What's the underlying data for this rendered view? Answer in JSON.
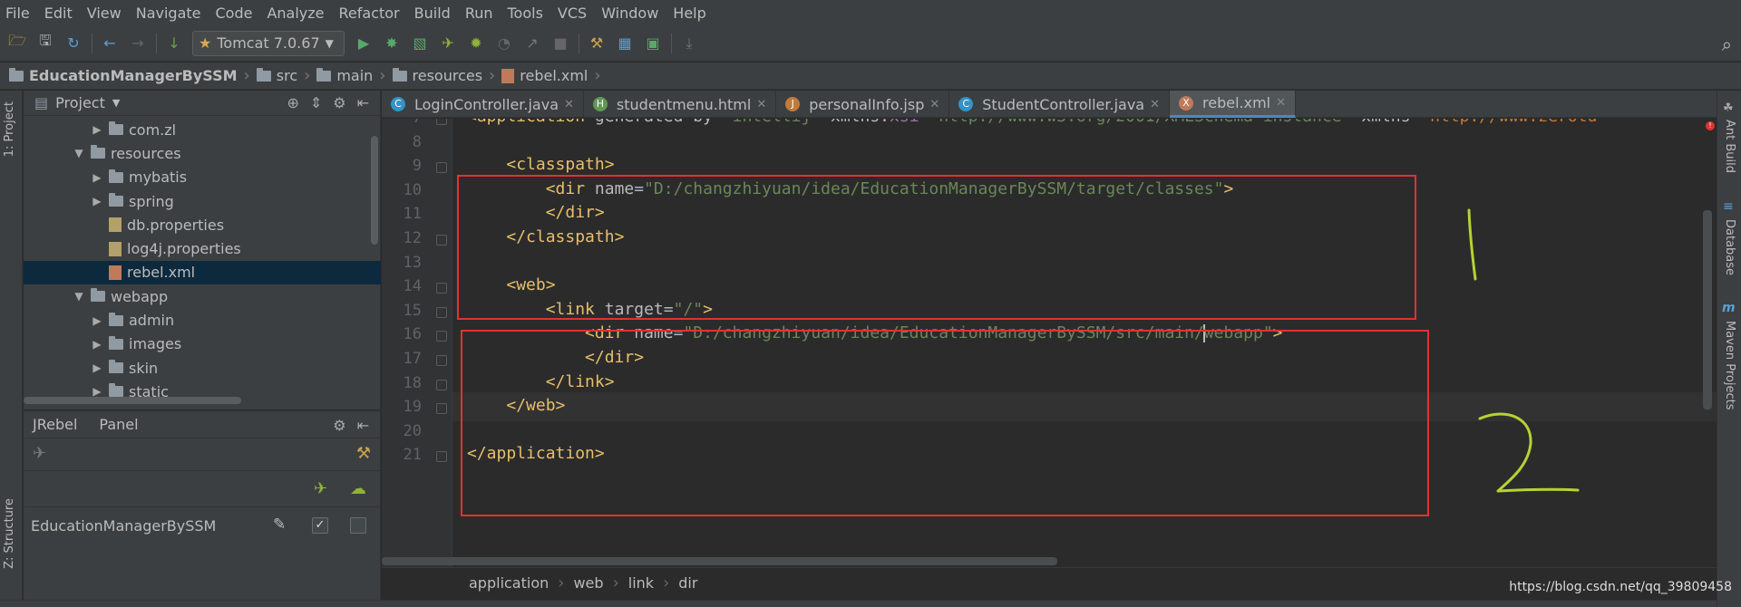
{
  "menu": [
    "File",
    "Edit",
    "View",
    "Navigate",
    "Code",
    "Analyze",
    "Refactor",
    "Build",
    "Run",
    "Tools",
    "VCS",
    "Window",
    "Help"
  ],
  "toolbar": {
    "run_config": "Tomcat 7.0.67"
  },
  "breadcrumb": [
    "EducationManagerBySSM",
    "src",
    "main",
    "resources",
    "rebel.xml"
  ],
  "left_strip": {
    "project_tab": "1: Project",
    "structure_tab": "Z: Structure"
  },
  "project_panel": {
    "title": "Project",
    "tree": [
      {
        "label": "com.zl",
        "type": "folder",
        "expanded": false,
        "level": 2
      },
      {
        "label": "resources",
        "type": "folder",
        "expanded": true,
        "level": 1
      },
      {
        "label": "mybatis",
        "type": "folder",
        "expanded": false,
        "level": 2
      },
      {
        "label": "spring",
        "type": "folder",
        "expanded": false,
        "level": 2
      },
      {
        "label": "db.properties",
        "type": "properties",
        "level": 2
      },
      {
        "label": "log4j.properties",
        "type": "properties",
        "level": 2
      },
      {
        "label": "rebel.xml",
        "type": "xml",
        "level": 2,
        "selected": true
      },
      {
        "label": "webapp",
        "type": "folder",
        "expanded": true,
        "level": 1
      },
      {
        "label": "admin",
        "type": "folder",
        "expanded": false,
        "level": 2
      },
      {
        "label": "images",
        "type": "folder",
        "expanded": false,
        "level": 2
      },
      {
        "label": "skin",
        "type": "folder",
        "expanded": false,
        "level": 2
      },
      {
        "label": "static",
        "type": "folder",
        "expanded": false,
        "level": 2
      }
    ]
  },
  "jrebel_panel": {
    "title": "JRebel",
    "subtitle": "Panel",
    "module": "EducationManagerBySSM",
    "jrebel_checked": true,
    "remote_checked": false
  },
  "tabs": [
    {
      "label": "LoginController.java",
      "icon": "C",
      "color": "#3592c4"
    },
    {
      "label": "studentmenu.html",
      "icon": "H",
      "color": "#629755"
    },
    {
      "label": "personalInfo.jsp",
      "icon": "J",
      "color": "#c07a3a"
    },
    {
      "label": "StudentController.java",
      "icon": "C",
      "color": "#3592c4"
    },
    {
      "label": "rebel.xml",
      "icon": "X",
      "color": "#c07a5a",
      "active": true
    }
  ],
  "code_lines": [
    {
      "n": "7",
      "parts": [
        [
          "t-tag",
          "<application "
        ],
        [
          "t-attr",
          "generated-by"
        ],
        [
          "t-plain",
          "="
        ],
        [
          "t-val",
          "\"intellij\""
        ],
        [
          "t-plain",
          " "
        ],
        [
          "t-attr",
          "xmlns:"
        ],
        [
          "t-ns",
          "xsi"
        ],
        [
          "t-plain",
          "="
        ],
        [
          "t-val",
          "\"http://www.w3.org/2001/XMLSchema-instance\""
        ],
        [
          "t-plain",
          " "
        ],
        [
          "t-attr",
          "xmlns"
        ],
        [
          "t-plain",
          "="
        ],
        [
          "t-url",
          "\"http://www.zerotu"
        ]
      ]
    },
    {
      "n": "8",
      "parts": []
    },
    {
      "n": "9",
      "parts": [
        [
          "t-plain",
          "    "
        ],
        [
          "t-tag",
          "<classpath>"
        ]
      ]
    },
    {
      "n": "10",
      "parts": [
        [
          "t-plain",
          "        "
        ],
        [
          "t-tag",
          "<dir "
        ],
        [
          "t-attr",
          "name"
        ],
        [
          "t-plain",
          "="
        ],
        [
          "t-val",
          "\"D:/changzhiyuan/idea/EducationManagerBySSM/target/classes\""
        ],
        [
          "t-tag",
          ">"
        ]
      ]
    },
    {
      "n": "11",
      "parts": [
        [
          "t-plain",
          "        "
        ],
        [
          "t-tag",
          "</dir>"
        ]
      ]
    },
    {
      "n": "12",
      "parts": [
        [
          "t-plain",
          "    "
        ],
        [
          "t-tag",
          "</classpath>"
        ]
      ]
    },
    {
      "n": "13",
      "parts": []
    },
    {
      "n": "14",
      "parts": [
        [
          "t-plain",
          "    "
        ],
        [
          "t-tag",
          "<web>"
        ]
      ]
    },
    {
      "n": "15",
      "parts": [
        [
          "t-plain",
          "        "
        ],
        [
          "t-tag",
          "<link "
        ],
        [
          "t-attr",
          "target"
        ],
        [
          "t-plain",
          "="
        ],
        [
          "t-val",
          "\"/\""
        ],
        [
          "t-tag",
          ">"
        ]
      ]
    },
    {
      "n": "16",
      "parts": [
        [
          "t-plain",
          "            "
        ],
        [
          "t-tag",
          "<dir "
        ],
        [
          "t-attr",
          "name"
        ],
        [
          "t-plain",
          "="
        ],
        [
          "t-val",
          "\"D:/changzhiyuan/idea/EducationManagerBySSM/src/main/"
        ],
        [
          "caret",
          ""
        ],
        [
          "t-val",
          "webapp\""
        ],
        [
          "t-tag",
          ">"
        ]
      ]
    },
    {
      "n": "17",
      "parts": [
        [
          "t-plain",
          "            "
        ],
        [
          "t-tag",
          "</dir>"
        ]
      ]
    },
    {
      "n": "18",
      "parts": [
        [
          "t-plain",
          "        "
        ],
        [
          "t-tag",
          "</link>"
        ]
      ]
    },
    {
      "n": "19",
      "parts": [
        [
          "t-plain",
          "    "
        ],
        [
          "t-tag",
          "</web>"
        ]
      ]
    },
    {
      "n": "20",
      "parts": []
    },
    {
      "n": "21",
      "parts": [
        [
          "t-tag",
          "</application>"
        ]
      ]
    }
  ],
  "editor_breadcrumb": [
    "application",
    "web",
    "link",
    "dir"
  ],
  "right_strip": [
    "Ant Build",
    "Database",
    "Maven Projects"
  ],
  "annotations": [
    "1",
    "2"
  ],
  "watermark": "https://blog.csdn.net/qq_39809458",
  "colors": {
    "annotation_box": "#e03232",
    "annotation_ink": "#b5d334",
    "selection": "#0d293e",
    "active_tab_underline": "#4a88c7"
  }
}
